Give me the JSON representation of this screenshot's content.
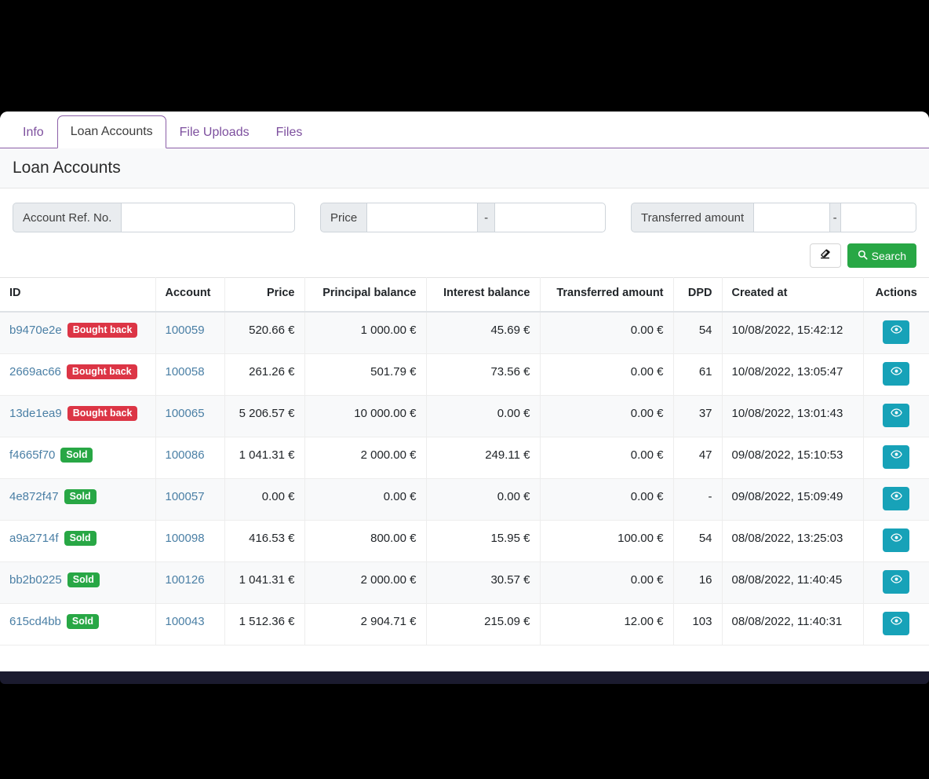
{
  "tabs": [
    {
      "label": "Info",
      "active": false
    },
    {
      "label": "Loan Accounts",
      "active": true
    },
    {
      "label": "File Uploads",
      "active": false
    },
    {
      "label": "Files",
      "active": false
    }
  ],
  "section": {
    "title": "Loan Accounts"
  },
  "filters": {
    "account_ref": {
      "label": "Account Ref. No.",
      "value": "",
      "placeholder": ""
    },
    "price": {
      "label": "Price",
      "from": "",
      "to": "",
      "separator": "-"
    },
    "transferred_amount": {
      "label": "Transferred amount",
      "from": "",
      "to": "",
      "separator": "-"
    },
    "clear_icon": "eraser-icon",
    "search_label": "Search",
    "search_icon": "search-icon"
  },
  "table": {
    "columns": [
      "ID",
      "Account",
      "Price",
      "Principal balance",
      "Interest balance",
      "Transferred amount",
      "DPD",
      "Created at",
      "Actions"
    ],
    "view_icon": "eye-icon",
    "rows": [
      {
        "id": "b9470e2e",
        "status": "Bought back",
        "status_kind": "bought",
        "account": "100059",
        "price": "520.66 €",
        "principal_balance": "1 000.00 €",
        "interest_balance": "45.69 €",
        "transferred_amount": "0.00 €",
        "dpd": "54",
        "created_at": "10/08/2022, 15:42:12"
      },
      {
        "id": "2669ac66",
        "status": "Bought back",
        "status_kind": "bought",
        "account": "100058",
        "price": "261.26 €",
        "principal_balance": "501.79 €",
        "interest_balance": "73.56 €",
        "transferred_amount": "0.00 €",
        "dpd": "61",
        "created_at": "10/08/2022, 13:05:47"
      },
      {
        "id": "13de1ea9",
        "status": "Bought back",
        "status_kind": "bought",
        "account": "100065",
        "price": "5 206.57 €",
        "principal_balance": "10 000.00 €",
        "interest_balance": "0.00 €",
        "transferred_amount": "0.00 €",
        "dpd": "37",
        "created_at": "10/08/2022, 13:01:43"
      },
      {
        "id": "f4665f70",
        "status": "Sold",
        "status_kind": "sold",
        "account": "100086",
        "price": "1 041.31 €",
        "principal_balance": "2 000.00 €",
        "interest_balance": "249.11 €",
        "transferred_amount": "0.00 €",
        "dpd": "47",
        "created_at": "09/08/2022, 15:10:53"
      },
      {
        "id": "4e872f47",
        "status": "Sold",
        "status_kind": "sold",
        "account": "100057",
        "price": "0.00 €",
        "principal_balance": "0.00 €",
        "interest_balance": "0.00 €",
        "transferred_amount": "0.00 €",
        "dpd": "-",
        "created_at": "09/08/2022, 15:09:49"
      },
      {
        "id": "a9a2714f",
        "status": "Sold",
        "status_kind": "sold",
        "account": "100098",
        "price": "416.53 €",
        "principal_balance": "800.00 €",
        "interest_balance": "15.95 €",
        "transferred_amount": "100.00 €",
        "dpd": "54",
        "created_at": "08/08/2022, 13:25:03"
      },
      {
        "id": "bb2b0225",
        "status": "Sold",
        "status_kind": "sold",
        "account": "100126",
        "price": "1 041.31 €",
        "principal_balance": "2 000.00 €",
        "interest_balance": "30.57 €",
        "transferred_amount": "0.00 €",
        "dpd": "16",
        "created_at": "08/08/2022, 11:40:45"
      },
      {
        "id": "615cd4bb",
        "status": "Sold",
        "status_kind": "sold",
        "account": "100043",
        "price": "1 512.36 €",
        "principal_balance": "2 904.71 €",
        "interest_balance": "215.09 €",
        "transferred_amount": "12.00 €",
        "dpd": "103",
        "created_at": "08/08/2022, 11:40:31"
      }
    ]
  },
  "colors": {
    "tab_accent": "#7d4f9e",
    "search_green": "#28a745",
    "badge_red": "#dc3545",
    "badge_green": "#28a745",
    "view_teal": "#17a2b8",
    "link_blue": "#4a7fa5"
  }
}
